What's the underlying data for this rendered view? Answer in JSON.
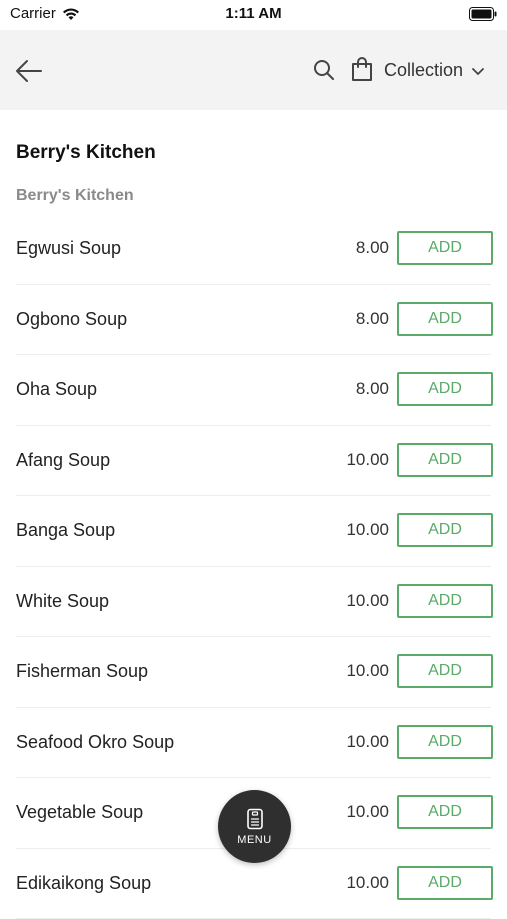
{
  "status_bar": {
    "carrier": "Carrier",
    "time": "1:11 AM"
  },
  "header": {
    "collection_label": "Collection"
  },
  "store": {
    "title": "Berry's Kitchen",
    "section": "Berry's Kitchen"
  },
  "items": [
    {
      "name": "Egwusi Soup",
      "price": "8.00",
      "add_label": "ADD"
    },
    {
      "name": "Ogbono Soup",
      "price": "8.00",
      "add_label": "ADD"
    },
    {
      "name": "Oha Soup",
      "price": "8.00",
      "add_label": "ADD"
    },
    {
      "name": "Afang Soup",
      "price": "10.00",
      "add_label": "ADD"
    },
    {
      "name": "Banga Soup",
      "price": "10.00",
      "add_label": "ADD"
    },
    {
      "name": "White Soup",
      "price": "10.00",
      "add_label": "ADD"
    },
    {
      "name": "Fisherman Soup",
      "price": "10.00",
      "add_label": "ADD"
    },
    {
      "name": "Seafood Okro Soup",
      "price": "10.00",
      "add_label": "ADD"
    },
    {
      "name": "Vegetable Soup",
      "price": "10.00",
      "add_label": "ADD"
    },
    {
      "name": "Edikaikong Soup",
      "price": "10.00",
      "add_label": "ADD"
    }
  ],
  "fab": {
    "label": "MENU",
    "icon": "menu-book-icon"
  },
  "colors": {
    "accent": "#5aaa6a",
    "header_bg": "#f3f3f3",
    "fab_bg": "#2f2f2f"
  }
}
